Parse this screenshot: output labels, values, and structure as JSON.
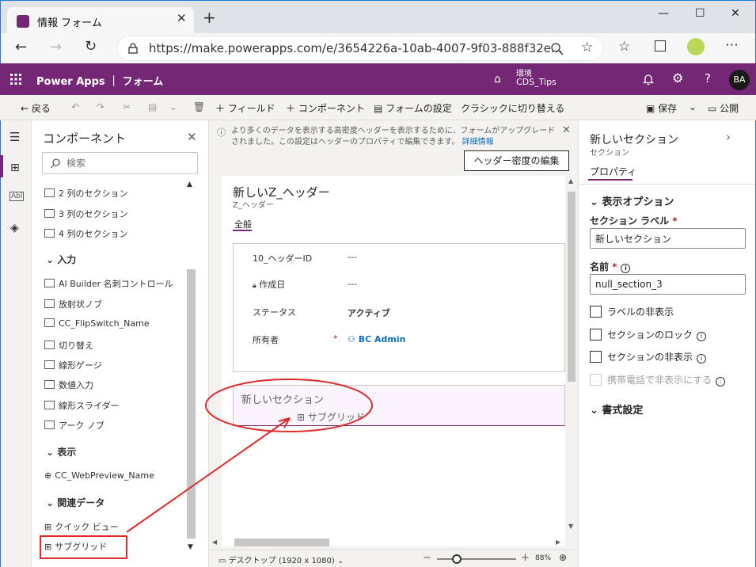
{
  "browser": {
    "tab_title": "情報 フォーム",
    "url": "https://make.powerapps.com/e/3654226a-10ab-4007-9f03-888f32e..."
  },
  "appbar": {
    "app_name": "Power Apps ｜ フォーム",
    "env_label": "環境",
    "env_name": "CDS_Tips",
    "avatar": "BA"
  },
  "commands": {
    "back": "戻る",
    "field": "フィールド",
    "component": "コンポーネント",
    "form_settings": "フォームの設定",
    "switch_classic": "クラシックに切り替える",
    "save": "保存",
    "publish": "公開"
  },
  "components": {
    "title": "コンポーネント",
    "search_placeholder": "検索",
    "layout_items": [
      "2 列のセクション",
      "3 列のセクション",
      "4 列のセクション"
    ],
    "input_header": "入力",
    "input_items": [
      "AI Builder 名刺コントロール",
      "放射状ノブ",
      "CC_FlipSwitch_Name",
      "切り替え",
      "線形ゲージ",
      "数値入力",
      "線形スライダー",
      "アーク ノブ"
    ],
    "display_header": "表示",
    "display_items": [
      "CC_WebPreview_Name"
    ],
    "related_header": "関連データ",
    "related_items": [
      "クイック ビュー",
      "サブグリッド"
    ]
  },
  "banner": {
    "text": "より多くのデータを表示する高密度ヘッダーを表示するために、フォームがアップグレードされました。この設定はヘッダーのプロパティで編集できます。",
    "link": "詳細情報"
  },
  "header_button": "ヘッダー密度の編集",
  "form": {
    "title": "新しいZ_ヘッダー",
    "subtitle": "Z_ヘッダー",
    "tab": "全般",
    "fields": [
      {
        "label": "10_ヘッダーID",
        "value": "---"
      },
      {
        "label": "作成日",
        "value": "---"
      },
      {
        "label": "ステータス",
        "value": "アクティブ"
      },
      {
        "label": "所有者",
        "value": "BC Admin",
        "required": "*"
      }
    ],
    "new_section_title": "新しいセクション",
    "subgrid": "サブグリッド"
  },
  "statusbar": {
    "view": "デスクトップ (1920 x 1080)",
    "zoom": "88%",
    "zoom_level": 0.25
  },
  "properties": {
    "title": "新しいセクション",
    "subtitle": "セクション",
    "tab": "プロパティ",
    "display_options": "表示オプション",
    "label_label": "セクション ラベル",
    "label_value": "新しいセクション",
    "name_label": "名前",
    "name_value": "null_section_3",
    "hide_label": "ラベルの非表示",
    "lock_section": "セクションのロック",
    "hide_section": "セクションの非表示",
    "hide_on_phone": "携帯電話で非表示にする",
    "formatting": "書式設定"
  },
  "colors": {
    "brand": "#742774",
    "annotation_red": "#e02929"
  }
}
